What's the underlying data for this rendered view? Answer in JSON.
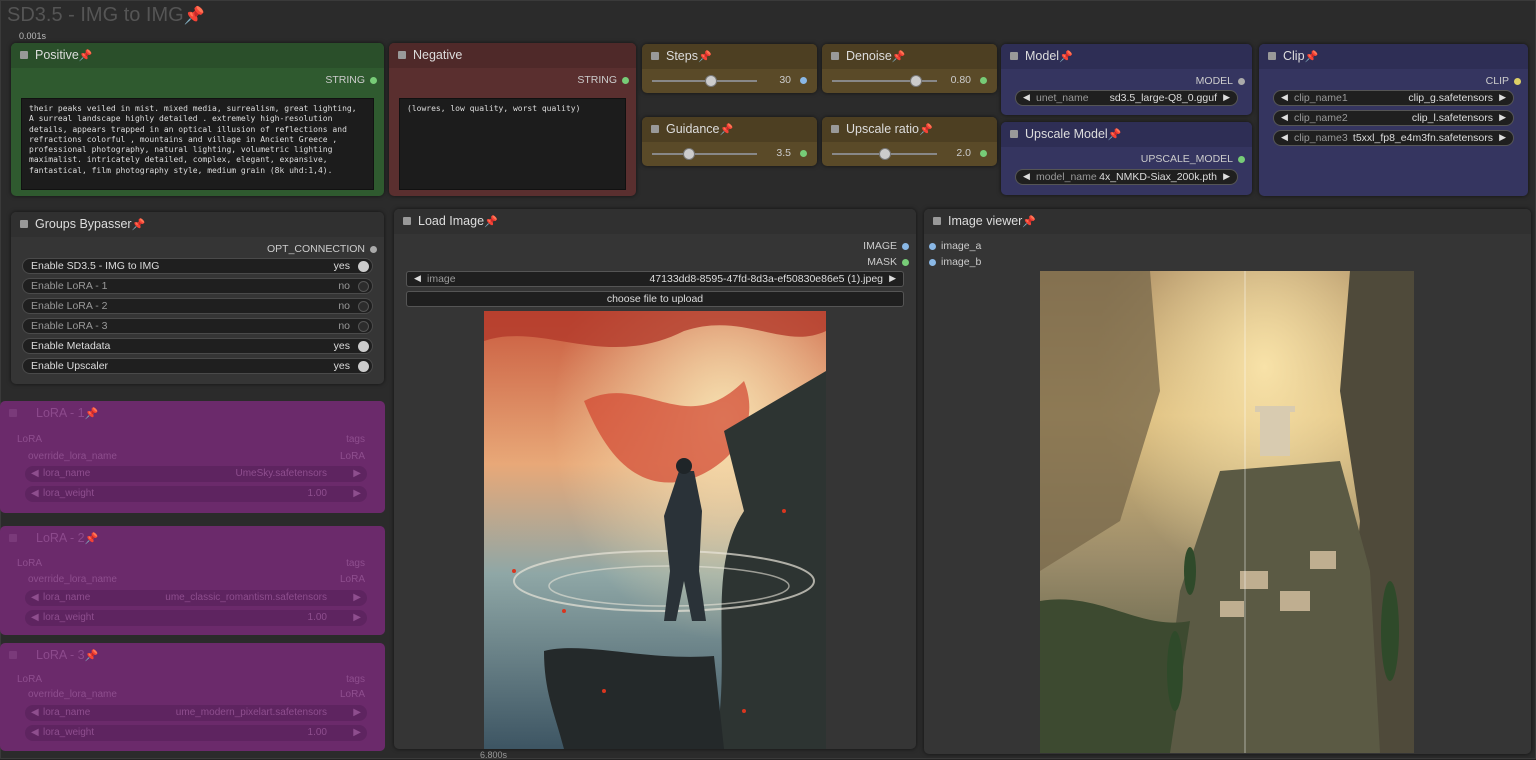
{
  "group": {
    "title": "SD3.5 - IMG to IMG",
    "exec_time": "0.001s",
    "bottom_time": "6.800s"
  },
  "positive": {
    "title": "Positive",
    "output": "STRING",
    "text": "their peaks veiled in mist. mixed media, surrealism, great lighting, A surreal landscape highly detailed . extremely high-resolution details, appears trapped in an optical illusion of reflections and refractions colorful , mountains and village in Ancient Greece , professional photography, natural lighting, volumetric lighting maximalist. intricately detailed, complex, elegant, expansive, fantastical, film photography style, medium grain  (8k uhd:1,4)."
  },
  "negative": {
    "title": "Negative",
    "output": "STRING",
    "text": "(lowres, low quality, worst quality)"
  },
  "steps": {
    "title": "Steps",
    "value": "30",
    "fraction": 0.56
  },
  "denoise": {
    "title": "Denoise",
    "value": "0.80",
    "fraction": 0.8
  },
  "guidance": {
    "title": "Guidance",
    "value": "3.5",
    "fraction": 0.35
  },
  "upscale_ratio": {
    "title": "Upscale ratio",
    "value": "2.0",
    "fraction": 0.5
  },
  "model": {
    "title": "Model",
    "output": "MODEL",
    "widget_label": "unet_name",
    "widget_value": "sd3.5_large-Q8_0.gguf"
  },
  "upscale_model": {
    "title": "Upscale Model",
    "output": "UPSCALE_MODEL",
    "widget_label": "model_name",
    "widget_value": "4x_NMKD-Siax_200k.pth"
  },
  "clip": {
    "title": "Clip",
    "output": "CLIP",
    "widgets": [
      {
        "label": "clip_name1",
        "value": "clip_g.safetensors"
      },
      {
        "label": "clip_name2",
        "value": "clip_l.safetensors"
      },
      {
        "label": "clip_name3",
        "value": "t5xxl_fp8_e4m3fn.safetensors"
      }
    ]
  },
  "bypasser": {
    "title": "Groups Bypasser",
    "output": "OPT_CONNECTION",
    "toggles": [
      {
        "label": "Enable SD3.5 - IMG to IMG",
        "value": "yes",
        "on": true
      },
      {
        "label": "Enable LoRA - 1",
        "value": "no",
        "on": false
      },
      {
        "label": "Enable LoRA - 2",
        "value": "no",
        "on": false
      },
      {
        "label": "Enable LoRA - 3",
        "value": "no",
        "on": false
      },
      {
        "label": "Enable Metadata",
        "value": "yes",
        "on": true
      },
      {
        "label": "Enable Upscaler",
        "value": "yes",
        "on": true
      }
    ]
  },
  "loras": [
    {
      "title": "LoRA - 1",
      "in1": "LoRA",
      "out1": "tags",
      "in2": "override_lora_name",
      "out2": "LoRA",
      "name_label": "lora_name",
      "name_value": "UmeSky.safetensors",
      "weight_label": "lora_weight",
      "weight_value": "1.00"
    },
    {
      "title": "LoRA - 2",
      "in1": "LoRA",
      "out1": "tags",
      "in2": "override_lora_name",
      "out2": "LoRA",
      "name_label": "lora_name",
      "name_value": "ume_classic_romantism.safetensors",
      "weight_label": "lora_weight",
      "weight_value": "1.00"
    },
    {
      "title": "LoRA - 3",
      "in1": "LoRA",
      "out1": "tags",
      "in2": "override_lora_name",
      "out2": "LoRA",
      "name_label": "lora_name",
      "name_value": "ume_modern_pixelart.safetensors",
      "weight_label": "lora_weight",
      "weight_value": "1.00"
    }
  ],
  "load_image": {
    "title": "Load Image",
    "out1": "IMAGE",
    "out2": "MASK",
    "widget_label": "image",
    "widget_value": "47133dd8-8595-47fd-8d3a-ef50830e86e5 (1).jpeg",
    "upload_label": "choose file to upload"
  },
  "image_viewer": {
    "title": "Image viewer",
    "in1": "image_a",
    "in2": "image_b"
  },
  "colors": {
    "positive": "#2d5a2d",
    "negative": "#5a2f2f",
    "primitive": "#5a4a28",
    "loader": "#353560",
    "lora": "#6b2a6b"
  }
}
